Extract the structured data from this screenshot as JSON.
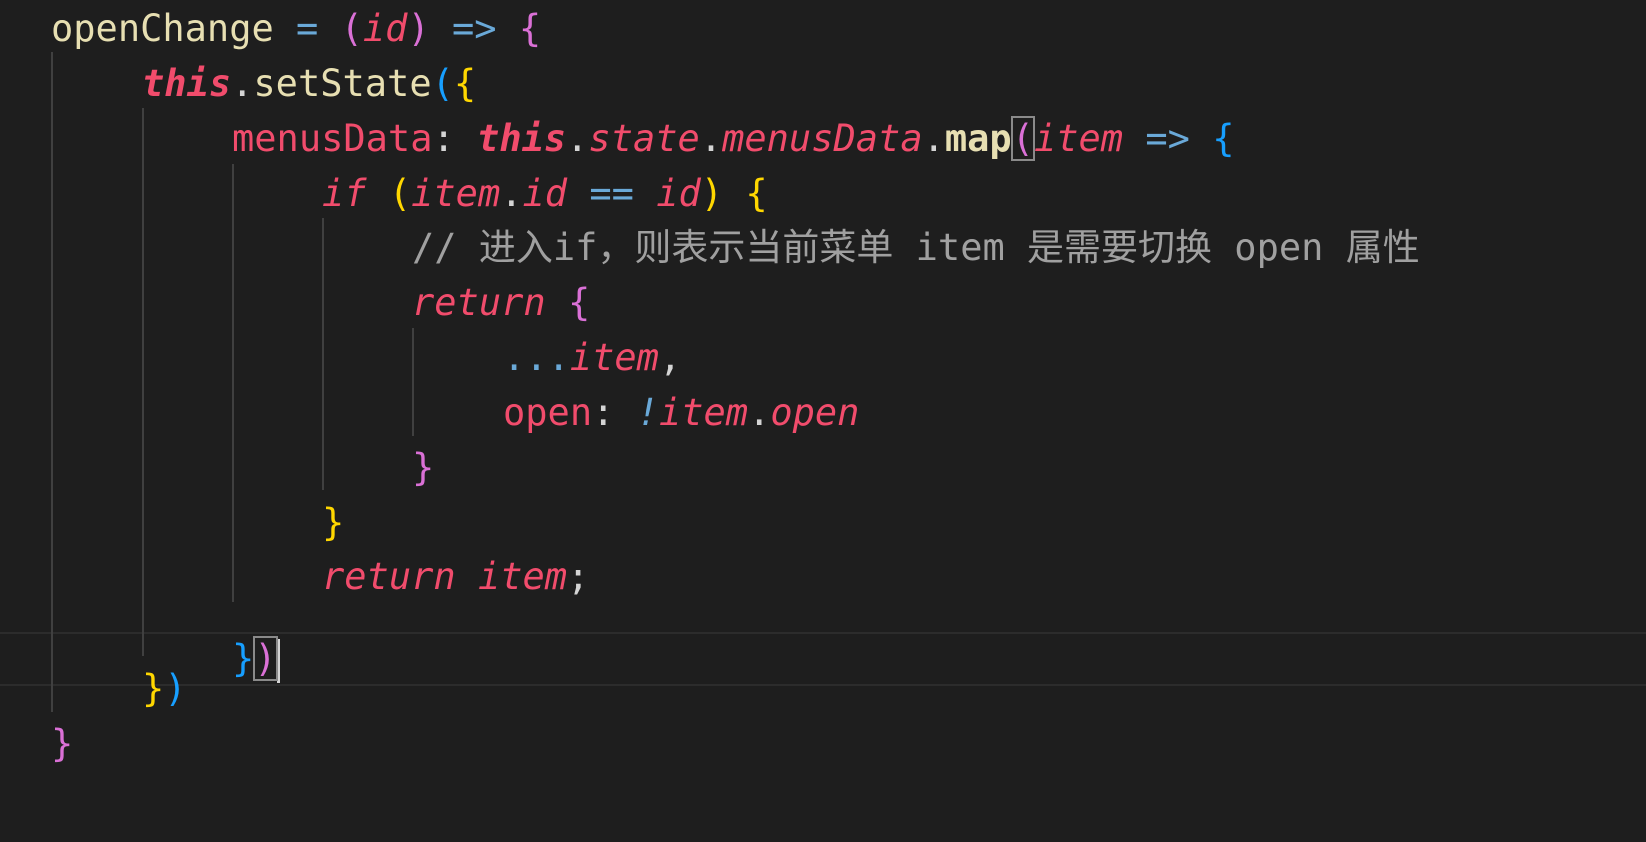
{
  "editor": {
    "theme_colors": {
      "background": "#1e1e1e",
      "keyword": "#f14c6c",
      "function": "#e7dfb2",
      "operator": "#6aa9d8",
      "bracket_level1": "#ffd700",
      "bracket_level2": "#da70d6",
      "bracket_level3": "#179fff",
      "comment": "#a0a0a0"
    },
    "code": {
      "l1": {
        "fn": "openChange",
        "eq": " = ",
        "po": "(",
        "param": "id",
        "pc": ")",
        "arrow": " => ",
        "brace": "{"
      },
      "l2": {
        "this": "this",
        "dot": ".",
        "method": "setState",
        "po": "(",
        "bo": "{"
      },
      "l3": {
        "prop": "menusData",
        "colon": ": ",
        "this": "this",
        "dot1": ".",
        "state": "state",
        "dot2": ".",
        "menus": "menusData",
        "dot3": ".",
        "map": "map",
        "po": "(",
        "item": "item",
        "arrow": " => ",
        "bo": "{"
      },
      "l4": {
        "kw": "if",
        "sp": " ",
        "po": "(",
        "item": "item",
        "dot": ".",
        "id": "id",
        "eq": " == ",
        "param": "id",
        "pc": ")",
        "sp2": " ",
        "bo": "{"
      },
      "l5": {
        "comment": "// 进入if，则表示当前菜单 item 是需要切换 open 属性"
      },
      "l6": {
        "kw": "return",
        "sp": " ",
        "bo": "{"
      },
      "l7": {
        "spread": "...",
        "item": "item",
        "comma": ","
      },
      "l8": {
        "prop": "open",
        "colon": ": ",
        "not": "!",
        "item": "item",
        "dot": ".",
        "open": "open"
      },
      "l9": {
        "bc": "}"
      },
      "l10": {
        "bc": "}"
      },
      "l11": {
        "kw": "return",
        "sp": " ",
        "item": "item",
        "semi": ";"
      },
      "l12": {
        "bc": "}",
        "pc": ")"
      },
      "l13": {
        "bc": "}",
        "pc": ")"
      },
      "l14": {
        "bc": "}"
      }
    }
  }
}
